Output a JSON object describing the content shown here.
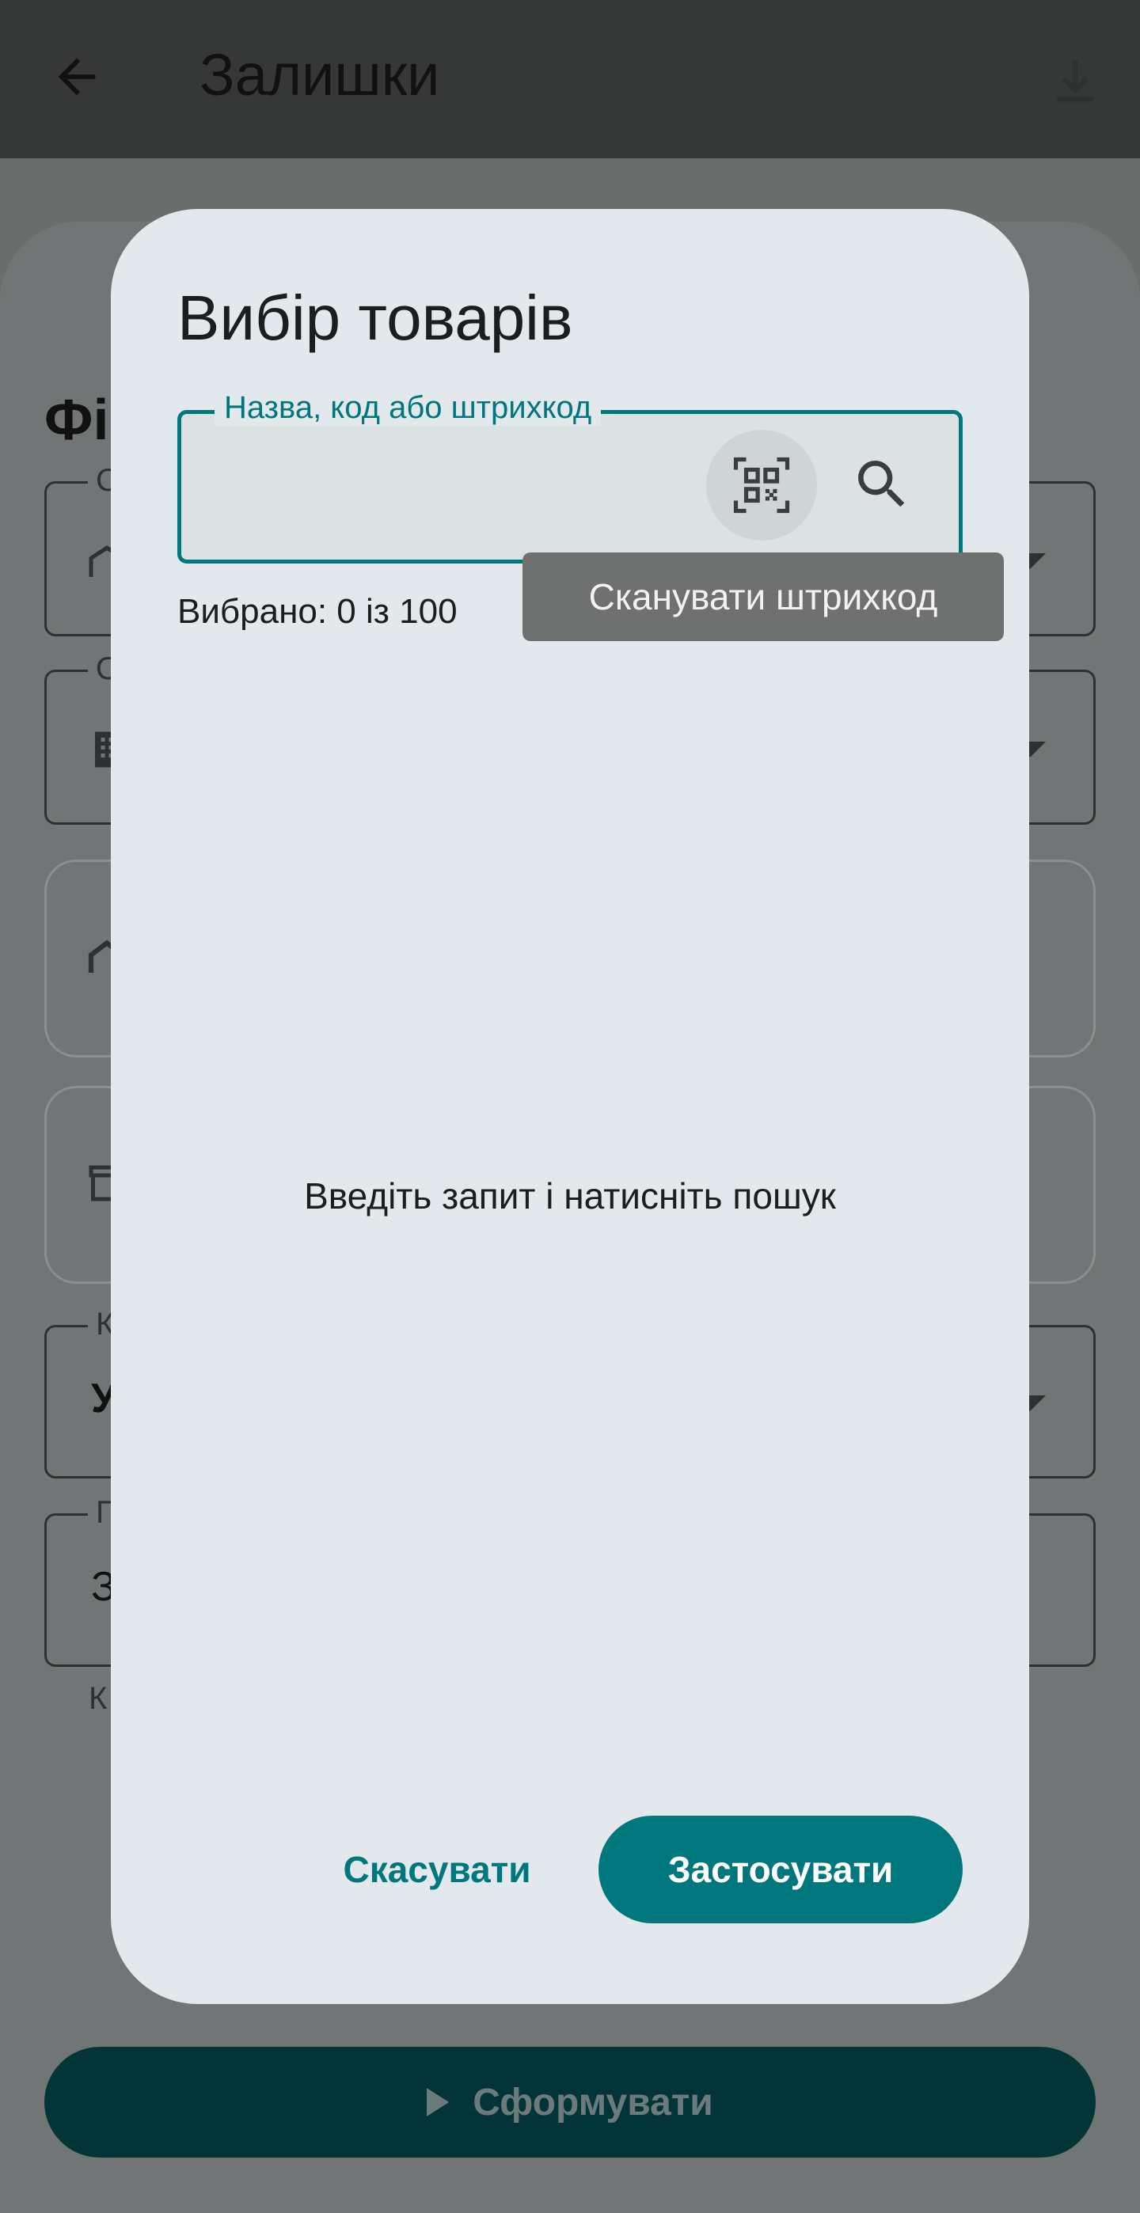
{
  "appbar": {
    "title": "Залишки",
    "back_icon": "arrow-left-icon",
    "download_icon": "download-icon"
  },
  "background": {
    "heading": "Фі",
    "fields": [
      {
        "label": "С",
        "icon": "store-icon"
      },
      {
        "label": "О",
        "icon": "building-icon"
      },
      {
        "label": "",
        "icon": "home-icon"
      },
      {
        "label": "",
        "icon": "box-icon"
      },
      {
        "label": "К",
        "value": "У"
      },
      {
        "label": "П",
        "value": "З"
      }
    ],
    "helper": "К",
    "generate_button": "Сформувати"
  },
  "dialog": {
    "title": "Вибір товарів",
    "search": {
      "label": "Назва, код або штрихкод",
      "value": "",
      "scan_icon": "qr-scan-icon",
      "search_icon": "search-icon"
    },
    "selected_count": "Вибрано: 0 із 100",
    "empty_hint": "Введіть запит і натисніть пошук",
    "cancel_button": "Скасувати",
    "apply_button": "Застосувати"
  },
  "tooltip": "Сканувати штрихкод",
  "colors": {
    "accent": "#00777d",
    "dialog_bg": "#e2e8eb",
    "scrim": "#6b6d6d"
  }
}
